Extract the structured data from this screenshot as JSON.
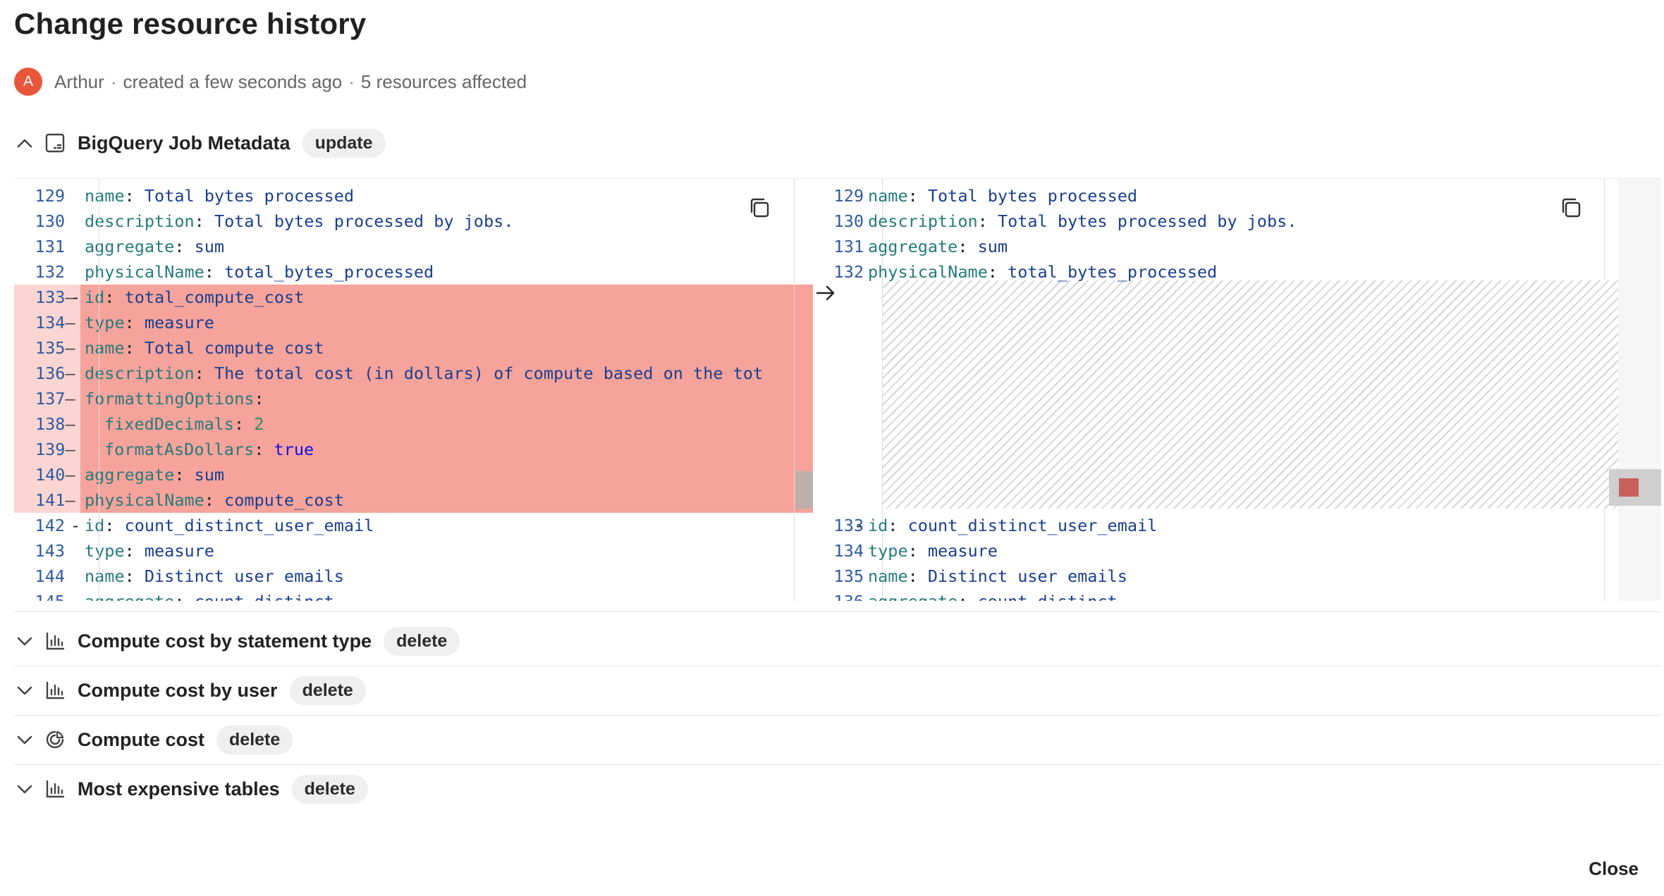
{
  "title": "Change resource history",
  "meta": {
    "avatar_letter": "A",
    "author": "Arthur",
    "separator": "·",
    "created": "created a few seconds ago",
    "affected": "5 resources affected"
  },
  "expanded_resource": {
    "name": "BigQuery Job Metadata",
    "badge": "update",
    "icon": "table-icon",
    "expanded": true
  },
  "diff": {
    "left_lines": [
      {
        "num": "129",
        "type": "normal",
        "indent": 1,
        "key": "name",
        "value": "Total bytes processed",
        "vclass": "v"
      },
      {
        "num": "130",
        "type": "normal",
        "indent": 1,
        "key": "description",
        "value": "Total bytes processed by jobs.",
        "vclass": "v"
      },
      {
        "num": "131",
        "type": "normal",
        "indent": 1,
        "key": "aggregate",
        "value": "sum",
        "vclass": "v"
      },
      {
        "num": "132",
        "type": "normal",
        "indent": 1,
        "key": "physicalName",
        "value": "total_bytes_processed",
        "vclass": "v"
      },
      {
        "num": "133",
        "type": "del",
        "fold": true,
        "indent": 1,
        "key": "id",
        "value": "total_compute_cost",
        "vclass": "v"
      },
      {
        "num": "134",
        "type": "del",
        "indent": 1,
        "key": "type",
        "value": "measure",
        "vclass": "v"
      },
      {
        "num": "135",
        "type": "del",
        "indent": 1,
        "key": "name",
        "value": "Total compute cost",
        "vclass": "v"
      },
      {
        "num": "136",
        "type": "del",
        "indent": 1,
        "key": "description",
        "value": "The total cost (in dollars) of compute based on the tot",
        "vclass": "v"
      },
      {
        "num": "137",
        "type": "del",
        "indent": 1,
        "key": "formattingOptions",
        "value": "",
        "vclass": "v"
      },
      {
        "num": "138",
        "type": "del",
        "indent": 2,
        "key": "fixedDecimals",
        "value": "2",
        "vclass": "n"
      },
      {
        "num": "139",
        "type": "del",
        "indent": 2,
        "key": "formatAsDollars",
        "value": "true",
        "vclass": "b"
      },
      {
        "num": "140",
        "type": "del",
        "indent": 1,
        "key": "aggregate",
        "value": "sum",
        "vclass": "v"
      },
      {
        "num": "141",
        "type": "del",
        "indent": 1,
        "key": "physicalName",
        "value": "compute_cost",
        "vclass": "v"
      },
      {
        "num": "142",
        "type": "normal",
        "fold": true,
        "indent": 1,
        "key": "id",
        "value": "count_distinct_user_email",
        "vclass": "v"
      },
      {
        "num": "143",
        "type": "normal",
        "indent": 1,
        "key": "type",
        "value": "measure",
        "vclass": "v"
      },
      {
        "num": "144",
        "type": "normal",
        "indent": 1,
        "key": "name",
        "value": "Distinct user emails",
        "vclass": "v"
      },
      {
        "num": "145",
        "type": "normal",
        "indent": 1,
        "key": "aggregate",
        "value": "count_distinct",
        "vclass": "v"
      }
    ],
    "right_lines": [
      {
        "row": 0,
        "num": "129",
        "fold": false,
        "indent": 1,
        "key": "name",
        "value": "Total bytes processed",
        "vclass": "v"
      },
      {
        "row": 1,
        "num": "130",
        "fold": false,
        "indent": 1,
        "key": "description",
        "value": "Total bytes processed by jobs.",
        "vclass": "v"
      },
      {
        "row": 2,
        "num": "131",
        "fold": false,
        "indent": 1,
        "key": "aggregate",
        "value": "sum",
        "vclass": "v"
      },
      {
        "row": 3,
        "num": "132",
        "fold": false,
        "indent": 1,
        "key": "physicalName",
        "value": "total_bytes_processed",
        "vclass": "v"
      },
      {
        "row": 13,
        "num": "133",
        "fold": true,
        "indent": 1,
        "key": "id",
        "value": "count_distinct_user_email",
        "vclass": "v"
      },
      {
        "row": 14,
        "num": "134",
        "fold": false,
        "indent": 1,
        "key": "type",
        "value": "measure",
        "vclass": "v"
      },
      {
        "row": 15,
        "num": "135",
        "fold": false,
        "indent": 1,
        "key": "name",
        "value": "Distinct user emails",
        "vclass": "v"
      },
      {
        "row": 16,
        "num": "136",
        "fold": false,
        "indent": 1,
        "key": "aggregate",
        "value": "count_distinct",
        "vclass": "v"
      }
    ]
  },
  "collapsed_resources": [
    {
      "name": "Compute cost by statement type",
      "badge": "delete",
      "icon": "bar-chart-icon"
    },
    {
      "name": "Compute cost by user",
      "badge": "delete",
      "icon": "bar-chart-icon"
    },
    {
      "name": "Compute cost",
      "badge": "delete",
      "icon": "gauge-icon"
    },
    {
      "name": "Most expensive tables",
      "badge": "delete",
      "icon": "bar-chart-icon"
    }
  ],
  "footer": {
    "close_label": "Close"
  }
}
